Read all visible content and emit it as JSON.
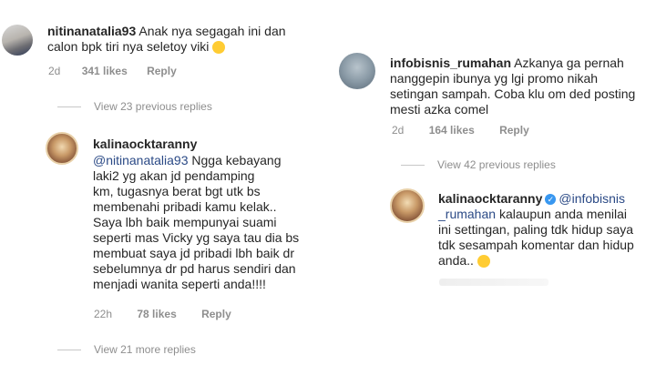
{
  "left": {
    "c1": {
      "username": "nitinanatalia93",
      "text_line1": "Anak nya segagah ini dan",
      "text_line2": "calon bpk tiri nya seletoy viki",
      "time": "2d",
      "likes": "341 likes",
      "reply": "Reply"
    },
    "view1": "View 23 previous replies",
    "c2": {
      "username": "kalinaocktaranny",
      "mention": "@nitinanatalia93",
      "lines": [
        "Ngga kebayang",
        "laki2 yg akan jd pendamping",
        "km, tugasnya berat bgt utk bs",
        "membenahi pribadi kamu kelak..",
        "Saya lbh baik mempunyai suami",
        "seperti mas Vicky yg saya tau dia bs",
        "membuat saya jd pribadi lbh baik dr",
        "sebelumnya dr pd harus sendiri dan",
        "menjadi wanita seperti anda!!!!"
      ],
      "time": "22h",
      "likes": "78 likes",
      "reply": "Reply"
    },
    "view2": "View 21 more replies"
  },
  "right": {
    "c1": {
      "username": "infobisnis_rumahan",
      "lines": [
        "Azkanya ga pernah",
        "nanggepin ibunya yg lgi promo nikah",
        "setingan sampah. Coba klu om ded posting",
        "mesti azka comel"
      ],
      "time": "2d",
      "likes": "164 likes",
      "reply": "Reply"
    },
    "view1": "View 42 previous replies",
    "c2": {
      "username": "kalinaocktaranny",
      "mention1": "@infobisnis",
      "mention2": "_rumahan",
      "lines": [
        "kalaupun anda menilai",
        "ini settingan, paling tdk hidup saya",
        "tdk sesampah komentar dan hidup",
        "anda.."
      ]
    }
  },
  "icons": {
    "laugh": "laughing-emoji-icon",
    "smile": "smiling-emoji-icon",
    "verified": "verified-badge-icon"
  }
}
